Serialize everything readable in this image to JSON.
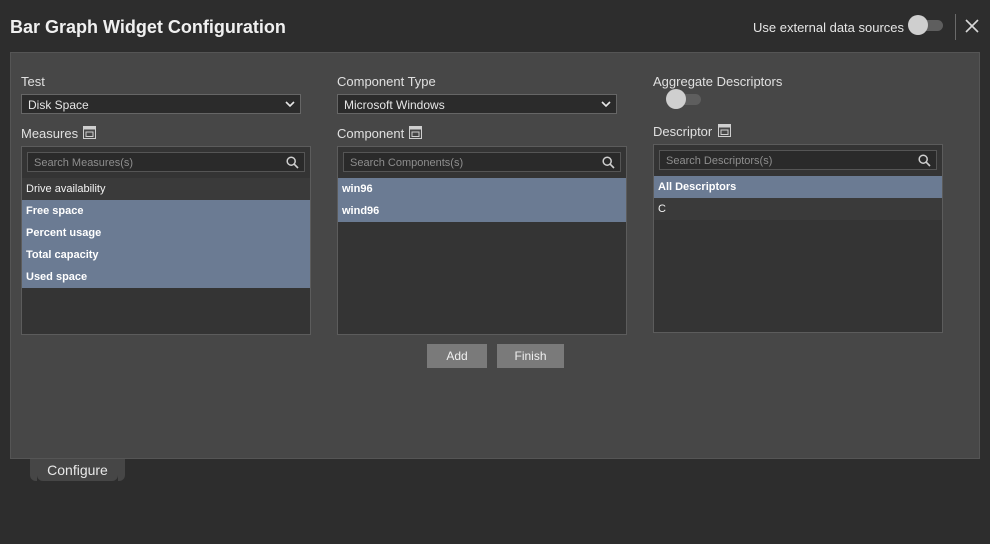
{
  "header": {
    "title": "Bar Graph Widget Configuration",
    "external_label": "Use external data sources"
  },
  "test": {
    "label": "Test",
    "value": "Disk Space"
  },
  "component_type": {
    "label": "Component Type",
    "value": "Microsoft Windows"
  },
  "aggregate": {
    "label": "Aggregate Descriptors"
  },
  "measures": {
    "label": "Measures",
    "search_placeholder": "Search Measures(s)",
    "items": [
      {
        "label": "Drive availability",
        "selected": false
      },
      {
        "label": "Free space",
        "selected": true
      },
      {
        "label": "Percent usage",
        "selected": true
      },
      {
        "label": "Total capacity",
        "selected": true
      },
      {
        "label": "Used space",
        "selected": true
      }
    ]
  },
  "component": {
    "label": "Component",
    "search_placeholder": "Search Components(s)",
    "items": [
      {
        "label": "win96",
        "selected": true
      },
      {
        "label": "wind96",
        "selected": true
      }
    ]
  },
  "descriptor": {
    "label": "Descriptor",
    "search_placeholder": "Search Descriptors(s)",
    "items": [
      {
        "label": "All Descriptors",
        "selected": true
      },
      {
        "label": "C",
        "selected": false
      }
    ]
  },
  "buttons": {
    "add": "Add",
    "finish": "Finish"
  },
  "tabs": {
    "configure": "Configure"
  }
}
